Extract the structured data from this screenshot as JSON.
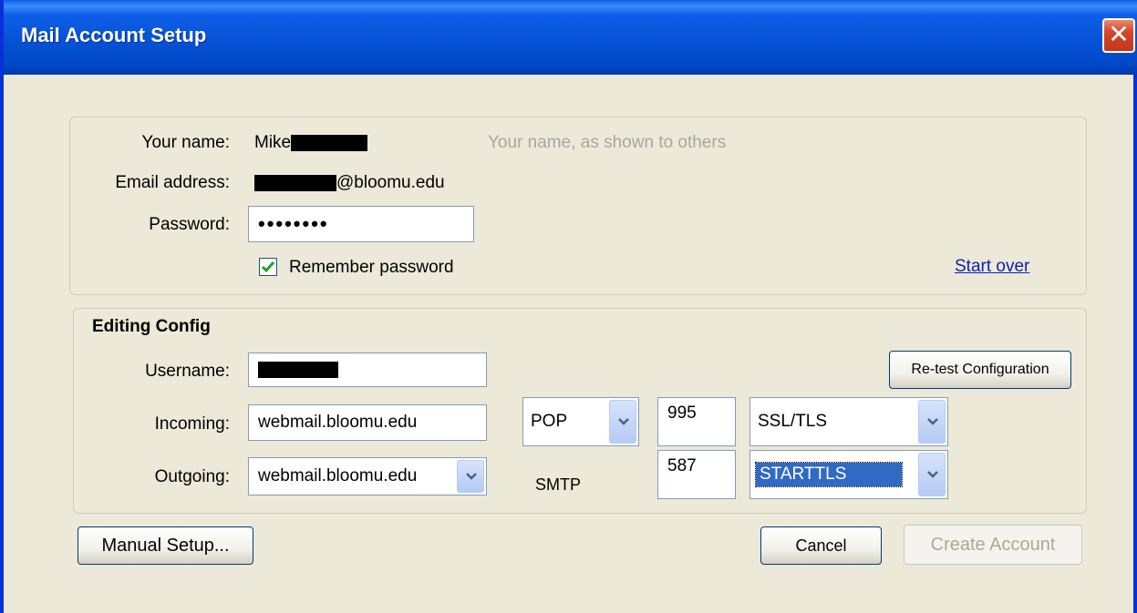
{
  "window": {
    "title": "Mail Account Setup",
    "close_glyph": "✕"
  },
  "identity": {
    "name_label": "Your name:",
    "name_value": "Mike",
    "name_hint": "Your name, as shown to others",
    "email_label": "Email address:",
    "email_value": "@bloomu.edu",
    "password_label": "Password:",
    "password_value": "••••••••",
    "remember_label": "Remember password",
    "remember_checked": true,
    "start_over": "Start over"
  },
  "config": {
    "heading": "Editing Config",
    "username_label": "Username:",
    "retest_label": "Re-test Configuration",
    "incoming_label": "Incoming:",
    "incoming_server": "webmail.bloomu.edu",
    "incoming_protocol": "POP",
    "incoming_port": "995",
    "incoming_security": "SSL/TLS",
    "outgoing_label": "Outgoing:",
    "outgoing_server": "webmail.bloomu.edu",
    "outgoing_protocol": "SMTP",
    "outgoing_port": "587",
    "outgoing_security": "STARTTLS"
  },
  "buttons": {
    "manual_setup": "Manual Setup...",
    "cancel": "Cancel",
    "create_account": "Create Account"
  }
}
